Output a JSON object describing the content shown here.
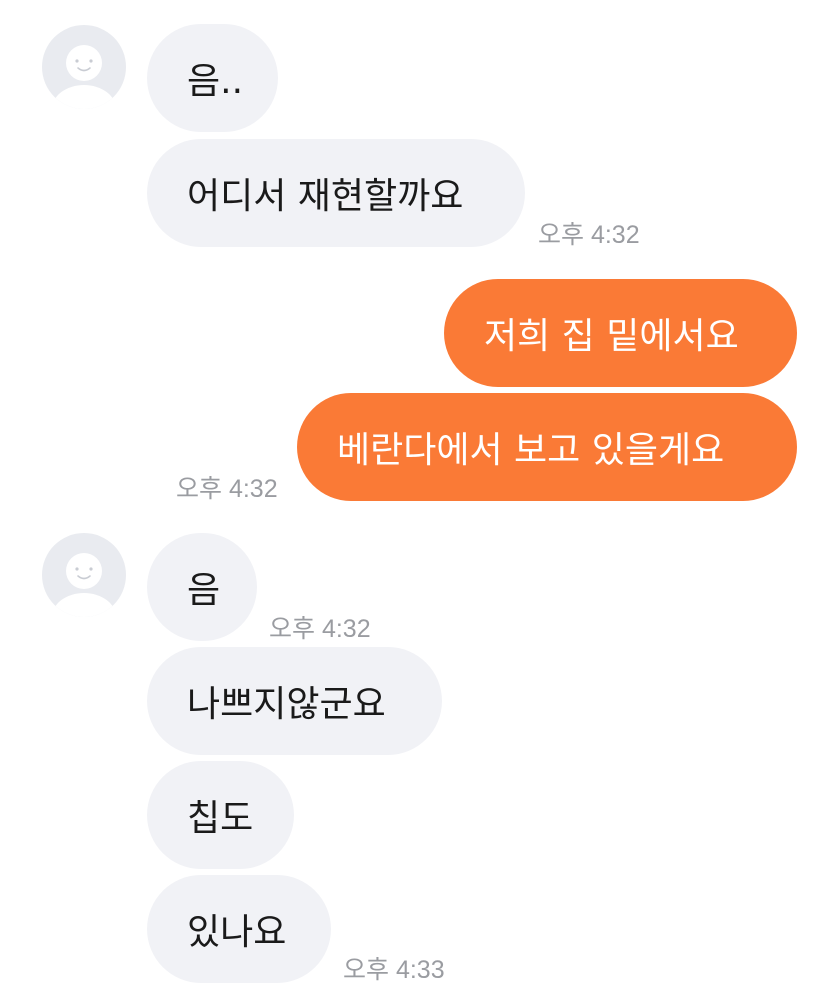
{
  "messages": [
    {
      "text": "음.."
    },
    {
      "text": "어디서 재현할까요"
    },
    {
      "text": "저희 집 밑에서요"
    },
    {
      "text": "베란다에서 보고 있을게요"
    },
    {
      "text": "음"
    },
    {
      "text": "나쁘지않군요"
    },
    {
      "text": "칩도"
    },
    {
      "text": "있나요"
    }
  ],
  "timestamps": [
    "오후 4:32",
    "오후 4:32",
    "오후 4:32",
    "오후 4:33"
  ],
  "colors": {
    "incoming_bubble": "#f1f2f6",
    "outgoing_bubble": "#fa7a36",
    "avatar_bg": "#e9ebf0",
    "timestamp": "#9a9ca1"
  }
}
